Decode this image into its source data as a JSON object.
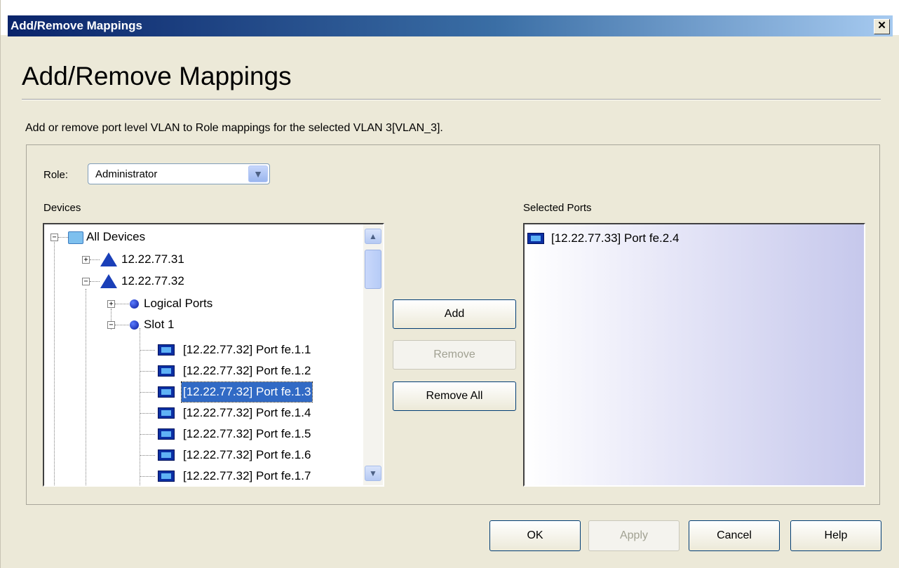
{
  "window": {
    "title": "Add/Remove Mappings",
    "close_glyph": "✕"
  },
  "heading": "Add/Remove Mappings",
  "description": "Add or remove port level VLAN to Role mappings for the selected VLAN 3[VLAN_3].",
  "role": {
    "label": "Role:",
    "value": "Administrator"
  },
  "devices": {
    "label": "Devices",
    "tree": [
      {
        "label": "All Devices",
        "icon": "folder-icon",
        "expander": "−"
      },
      {
        "label": "12.22.77.31",
        "icon": "device-icon",
        "expander": "+"
      },
      {
        "label": "12.22.77.32",
        "icon": "device-icon",
        "expander": "−"
      },
      {
        "label": "Logical Ports",
        "icon": "port-group-icon",
        "expander": "+"
      },
      {
        "label": "Slot 1",
        "icon": "port-group-icon",
        "expander": "−"
      },
      {
        "label": "[12.22.77.32] Port fe.1.1",
        "icon": "port-icon"
      },
      {
        "label": "[12.22.77.32] Port fe.1.2",
        "icon": "port-icon"
      },
      {
        "label": "[12.22.77.32] Port fe.1.3",
        "icon": "port-icon",
        "selected": true
      },
      {
        "label": "[12.22.77.32] Port fe.1.4",
        "icon": "port-icon"
      },
      {
        "label": "[12.22.77.32] Port fe.1.5",
        "icon": "port-icon"
      },
      {
        "label": "[12.22.77.32] Port fe.1.6",
        "icon": "port-icon"
      },
      {
        "label": "[12.22.77.32] Port fe.1.7",
        "icon": "port-icon"
      }
    ]
  },
  "actions": {
    "add": "Add",
    "remove": "Remove",
    "remove_all": "Remove All"
  },
  "selected_ports": {
    "label": "Selected Ports",
    "items": [
      {
        "label": "[12.22.77.33] Port fe.2.4",
        "icon": "port-icon"
      }
    ]
  },
  "footer": {
    "ok": "OK",
    "apply": "Apply",
    "cancel": "Cancel",
    "help": "Help"
  },
  "colors": {
    "selection": "#316ac5",
    "title_bar_start": "#0a246a",
    "dialog_bg": "#ece9d8",
    "port_icon": "#0b2fa3"
  }
}
